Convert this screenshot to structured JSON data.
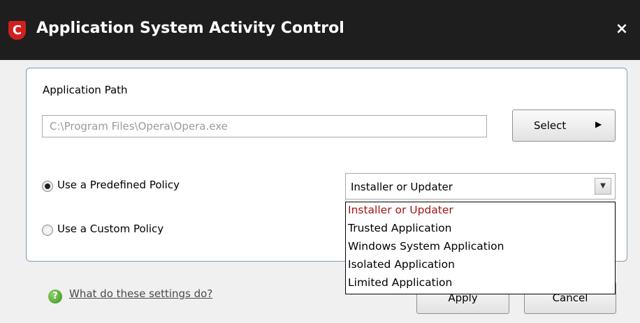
{
  "window": {
    "title": "Application System Activity Control",
    "logo_letter": "C",
    "close_glyph": "×"
  },
  "form": {
    "path_label": "Application Path",
    "path_value": "C:\\Program Files\\Opera\\Opera.exe",
    "select_button": "Select",
    "select_arrow": "▶",
    "predefined_label": "Use a Predefined Policy",
    "predefined_checked": true,
    "custom_label": "Use a Custom Policy",
    "custom_checked": false,
    "policy_selected": "Installer or Updater",
    "policy_dropdown_glyph": "▼"
  },
  "dropdown": {
    "options": [
      "Installer or Updater",
      "Trusted Application",
      "Windows System Application",
      "Isolated Application",
      "Limited Application"
    ],
    "highlighted_index": 0
  },
  "footer": {
    "help_icon_glyph": "?",
    "help_link": "What do these settings do?",
    "apply_button": "Apply",
    "cancel_button": "Cancel"
  },
  "colors": {
    "titlebar": "#1e1e1e",
    "logo": "#d0201e",
    "highlighted_option": "#a31515"
  }
}
